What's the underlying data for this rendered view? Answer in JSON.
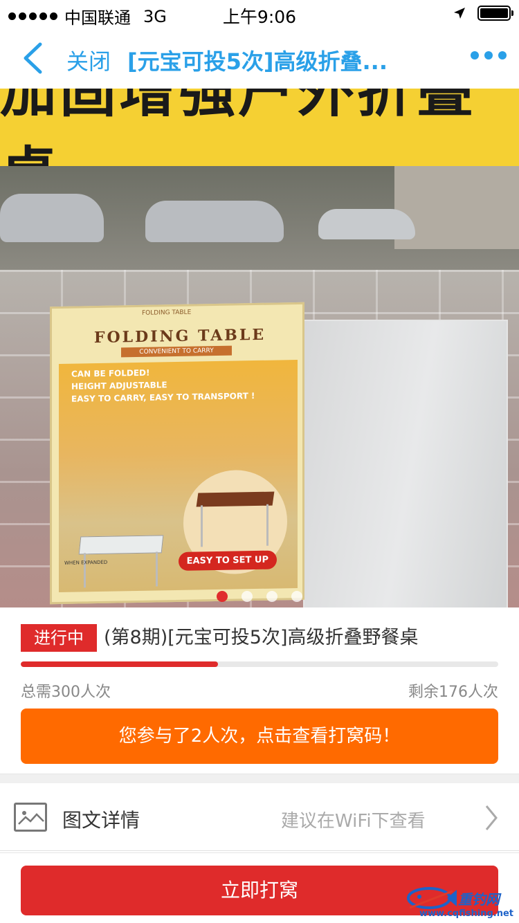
{
  "status_bar": {
    "carrier": "中国联通",
    "network": "3G",
    "time": "上午9:06"
  },
  "nav": {
    "close_label": "关闭",
    "title": "[元宝可投5次]高级折叠..."
  },
  "product_image": {
    "banner_text": "加固增强户外折叠桌",
    "box_title": "FOLDING TABLE",
    "box_subtitle": "CONVENIENT TO CARRY",
    "box_header": "FOLDING TABLE",
    "features": [
      "CAN BE FOLDED!",
      "HEIGHT ADJUSTABLE",
      "EASY TO CARRY, EASY TO TRANSPORT !"
    ],
    "when_expanded": "WHEN EXPANDED",
    "easy_badge": "EASY TO SET UP",
    "carousel_count": 4,
    "carousel_active": 0
  },
  "product": {
    "status": "进行中",
    "title": "(第8期)[元宝可投5次]高级折叠野餐桌",
    "progress_fraction": 0.413,
    "total": "总需300人次",
    "remaining": "剩余176人次",
    "participation": "您参与了2人次，点击查看打窝码！"
  },
  "details": {
    "label": "图文详情",
    "hint": "建议在WiFi下查看"
  },
  "bottom": {
    "snatch_label": "立即打窝"
  },
  "watermark": {
    "brand": "重钓网",
    "url": "www.cqfishing.net"
  },
  "colors": {
    "accent_blue": "#2aa0e8",
    "red": "#df2b2b",
    "orange": "#ff6a00",
    "banner_yellow": "#f5d033"
  }
}
